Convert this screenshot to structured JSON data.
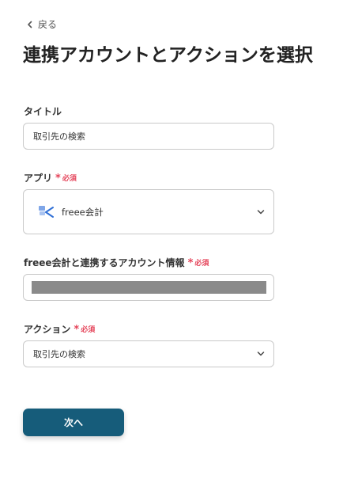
{
  "nav": {
    "back_label": "戻る"
  },
  "page": {
    "title": "連携アカウントとアクションを選択"
  },
  "form": {
    "title_field": {
      "label": "タイトル",
      "value": "取引先の検索"
    },
    "app_field": {
      "label": "アプリ",
      "required": "必須",
      "value": "freee会計",
      "icon": "freee-logo-icon"
    },
    "account_field": {
      "label": "freee会計と連携するアカウント情報",
      "required": "必須"
    },
    "action_field": {
      "label": "アクション",
      "required": "必須",
      "value": "取引先の検索"
    }
  },
  "buttons": {
    "next_label": "次へ"
  },
  "colors": {
    "primary": "#165c7a",
    "required": "#e54359",
    "redacted": "#8a8a8a"
  }
}
